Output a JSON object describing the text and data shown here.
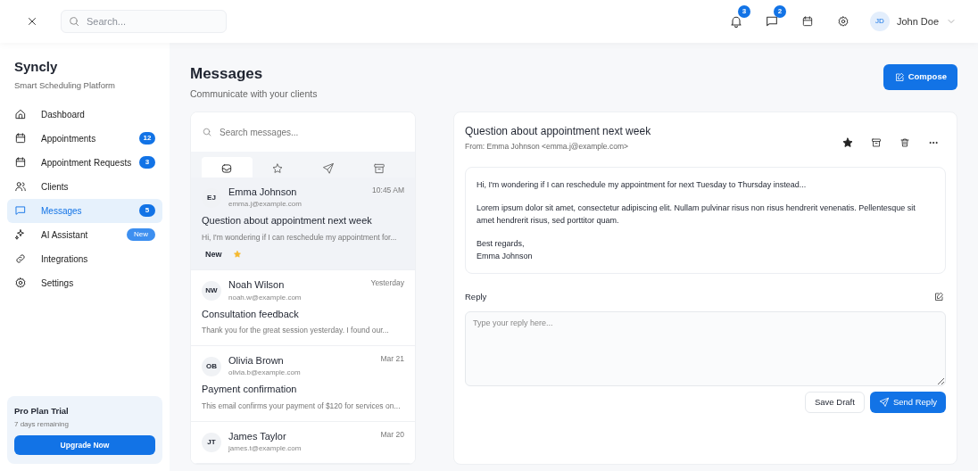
{
  "topbar": {
    "search_placeholder": "Search...",
    "notifications": "3",
    "messages": "2",
    "user": {
      "initials": "JD",
      "name": "John Doe"
    }
  },
  "sidebar": {
    "brand": "Syncly",
    "tagline": "Smart Scheduling Platform",
    "items": [
      {
        "label": "Dashboard",
        "kind": "plain",
        "selected": false
      },
      {
        "label": "Appointments",
        "badge": "12",
        "kind": "count",
        "selected": false
      },
      {
        "label": "Appointment Requests",
        "badge": "3",
        "kind": "count",
        "selected": false
      },
      {
        "label": "Clients",
        "kind": "plain",
        "selected": false
      },
      {
        "label": "Messages",
        "badge": "5",
        "kind": "count",
        "selected": true
      },
      {
        "label": "AI Assistant",
        "badge": "New",
        "kind": "new",
        "selected": false
      },
      {
        "label": "Integrations",
        "kind": "plain",
        "selected": false
      },
      {
        "label": "Settings",
        "kind": "plain",
        "selected": false
      }
    ],
    "promo": {
      "title": "Pro Plan Trial",
      "subtitle": "7 days remaining",
      "button": "Upgrade Now"
    }
  },
  "page": {
    "title": "Messages",
    "subtitle": "Communicate with your clients",
    "compose": "Compose"
  },
  "list": {
    "search_placeholder": "Search messages...",
    "tabs": [
      {
        "selected": true
      },
      {
        "selected": false
      },
      {
        "selected": false
      },
      {
        "selected": false
      }
    ],
    "messages": [
      {
        "initials": "EJ",
        "name": "Emma Johnson",
        "email": "emma.j@example.com",
        "time": "10:45 AM",
        "subject": "Question about appointment next week",
        "preview": "Hi, I'm wondering if I can reschedule my appointment for...",
        "new_label": "New",
        "starred": true,
        "selected": true
      },
      {
        "initials": "NW",
        "name": "Noah Wilson",
        "email": "noah.w@example.com",
        "time": "Yesterday",
        "subject": "Consultation feedback",
        "preview": "Thank you for the great session yesterday. I found our...",
        "starred": false,
        "selected": false
      },
      {
        "initials": "OB",
        "name": "Olivia Brown",
        "email": "olivia.b@example.com",
        "time": "Mar 21",
        "subject": "Payment confirmation",
        "preview": "This email confirms your payment of $120 for services on...",
        "starred": false,
        "selected": false
      },
      {
        "initials": "JT",
        "name": "James Taylor",
        "email": "james.t@example.com",
        "time": "Mar 20",
        "starred": false,
        "selected": false
      }
    ]
  },
  "detail": {
    "subject": "Question about appointment next week",
    "from": "From: Emma Johnson <emma.j@example.com>",
    "starred": true,
    "body": [
      "Hi, I'm wondering if I can reschedule my appointment for next Tuesday to Thursday instead...",
      "Lorem ipsum dolor sit amet, consectetur adipiscing elit. Nullam pulvinar risus non risus hendrerit venenatis. Pellentesque sit amet hendrerit risus, sed porttitor quam.",
      "Best regards,\nEmma Johnson"
    ],
    "reply_label": "Reply",
    "reply_placeholder": "Type your reply here...",
    "save": "Save Draft",
    "send": "Send Reply"
  }
}
